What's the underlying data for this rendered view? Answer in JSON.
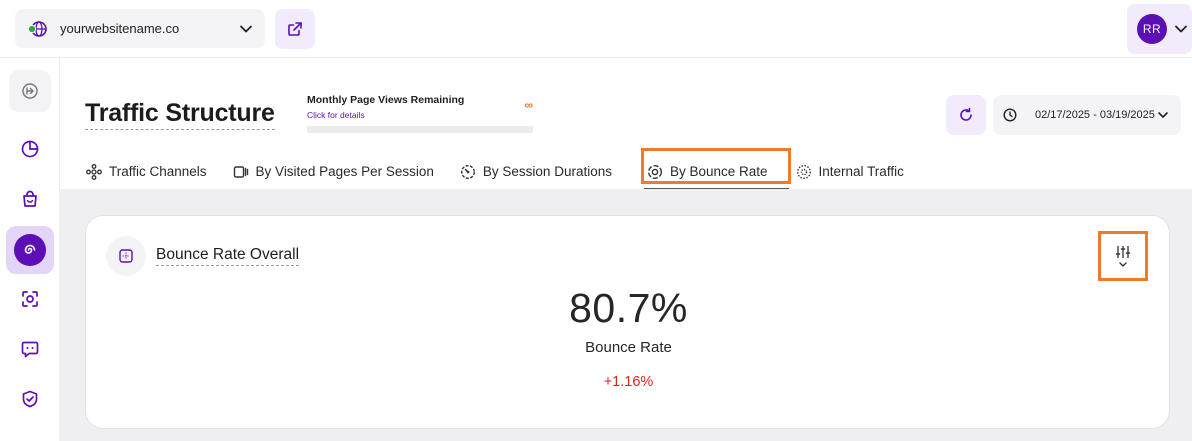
{
  "topbar": {
    "site_name": "yourwebsitename.co",
    "user_initials": "RR"
  },
  "header": {
    "page_title": "Traffic Structure",
    "page_views": {
      "title": "Monthly Page Views Remaining",
      "link": "Click for details",
      "remaining_symbol": "∞"
    },
    "date_range": "02/17/2025 - 03/19/2025"
  },
  "tabs": [
    {
      "label": "Traffic Channels",
      "icon": "share-nodes-icon"
    },
    {
      "label": "By Visited Pages Per Session",
      "icon": "pages-icon"
    },
    {
      "label": "By Session Durations",
      "icon": "timer-icon"
    },
    {
      "label": "By Bounce Rate",
      "icon": "bounce-icon",
      "selected": true
    },
    {
      "label": "Internal Traffic",
      "icon": "internal-traffic-icon"
    }
  ],
  "sidebar": {
    "items": [
      {
        "icon": "collapse-sidebar-icon"
      },
      {
        "icon": "analytics-pie-icon"
      },
      {
        "icon": "shop-bag-icon"
      },
      {
        "icon": "traffic-spiral-icon",
        "active": true
      },
      {
        "icon": "scan-icon"
      },
      {
        "icon": "chat-icon"
      },
      {
        "icon": "shield-icon"
      }
    ]
  },
  "card": {
    "title": "Bounce Rate Overall",
    "value": "80.7%",
    "label": "Bounce Rate",
    "delta": "+1.16%"
  },
  "colors": {
    "brand_purple": "#5b0fb5",
    "highlight_orange": "#f07a2a",
    "negative_red": "#d9271f"
  }
}
